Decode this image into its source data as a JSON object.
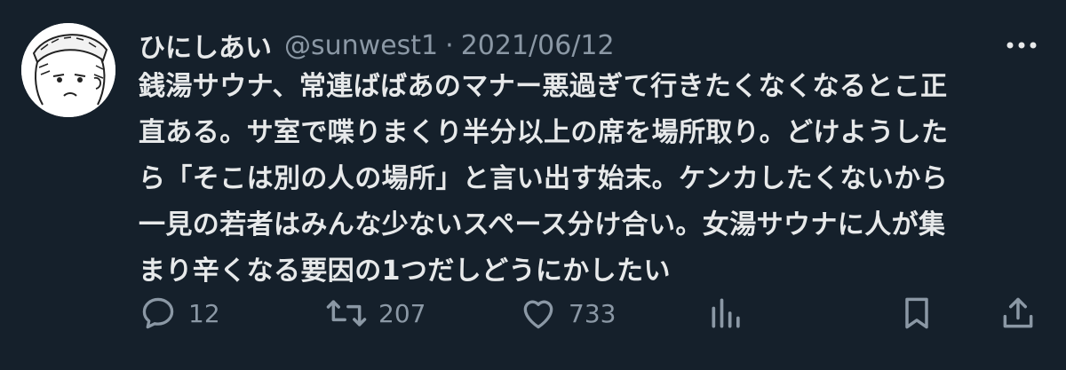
{
  "tweet": {
    "display_name": "ひにしあい",
    "handle": "@sunwest1",
    "separator": "·",
    "date": "2021/06/12",
    "text_lines": [
      "銭湯サウナ、常連ばばあのマナー悪過ぎて行きたくなくなるとこ正",
      "直ある。サ室で喋りまくり半分以上の席を場所取り。どけようした",
      "ら「そこは別の人の場所」と言い出す始末。ケンカしたくないから",
      "一見の若者はみんな少ないスペース分け合い。女湯サウナに人が集",
      "まり辛くなる要因の1つだしどうにかしたい"
    ]
  },
  "actions": {
    "reply": {
      "icon": "reply-icon",
      "count": "12"
    },
    "retweet": {
      "icon": "retweet-icon",
      "count": "207"
    },
    "like": {
      "icon": "heart-icon",
      "count": "733"
    },
    "views": {
      "icon": "views-icon"
    },
    "bookmark": {
      "icon": "bookmark-icon"
    },
    "share": {
      "icon": "share-icon"
    }
  },
  "colors": {
    "background": "#15202b",
    "text": "#e7e9ea",
    "muted": "#8b98a5"
  }
}
